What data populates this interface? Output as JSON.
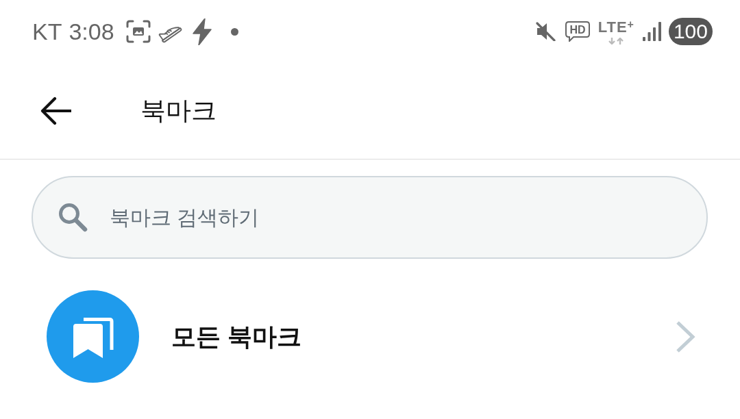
{
  "status_bar": {
    "carrier": "KT",
    "time": "3:08",
    "voice": "HD",
    "network": "LTE$^{+}$",
    "battery": "100"
  },
  "header": {
    "title": "북마크"
  },
  "search": {
    "placeholder": "북마크 검색하기"
  },
  "list": [
    {
      "label": "모든 북마크"
    }
  ]
}
